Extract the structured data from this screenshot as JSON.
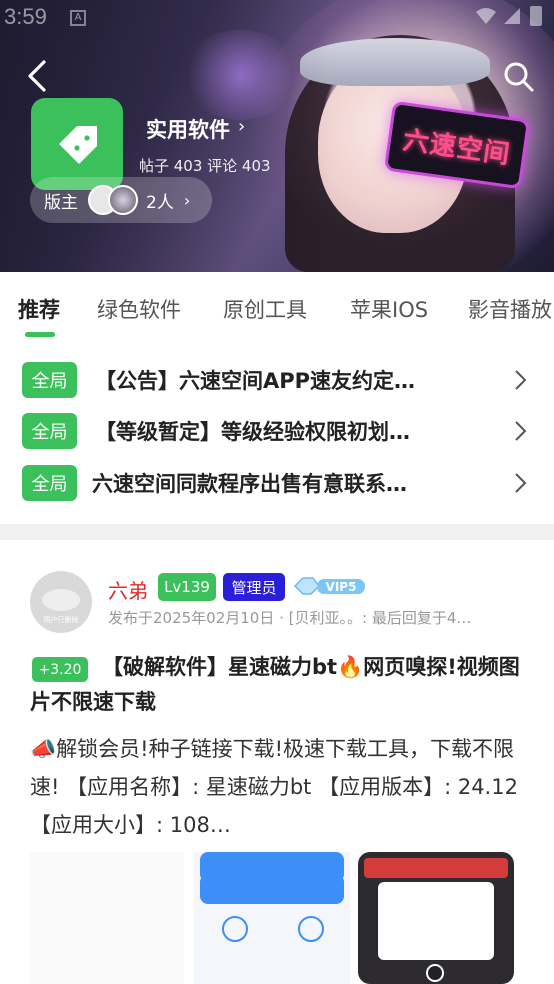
{
  "status_bar": {
    "time": "3:59",
    "notification_glyph": "A"
  },
  "banner": {
    "sign_text": "六速空间",
    "forum_name": "实用软件",
    "stats": "帖子 403 评论 403",
    "moderator_label": "版主",
    "moderator_count": "2人",
    "accent_color": "#3cc05b"
  },
  "tabs": [
    {
      "label": "推荐",
      "active": true
    },
    {
      "label": "绿色软件"
    },
    {
      "label": "原创工具"
    },
    {
      "label": "苹果IOS"
    },
    {
      "label": "影音播放"
    }
  ],
  "pinned": [
    {
      "badge": "全局",
      "title": "【公告】六速空间APP速友约定…"
    },
    {
      "badge": "全局",
      "title": "【等级暂定】等级经验权限初划…"
    },
    {
      "badge": "全局",
      "title": "六速空间同款程序出售有意联系…"
    }
  ],
  "post": {
    "avatar_caption": "用户已删除",
    "author": "六弟",
    "level": "Lv139",
    "role": "管理员",
    "vip": "VIP5",
    "meta": "发布于2025年02月10日 · [贝利亚。。: 最后回复于4…",
    "score": "+3.20",
    "title": "【破解软件】星速磁力bt🔥网页嗅探!视频图片不限速下载",
    "body": "📣解锁会员!种子链接下载!极速下载工具，下载不限速! 【应用名称】: 星速磁力bt 【应用版本】: 24.12 【应用大小】: 108…"
  }
}
